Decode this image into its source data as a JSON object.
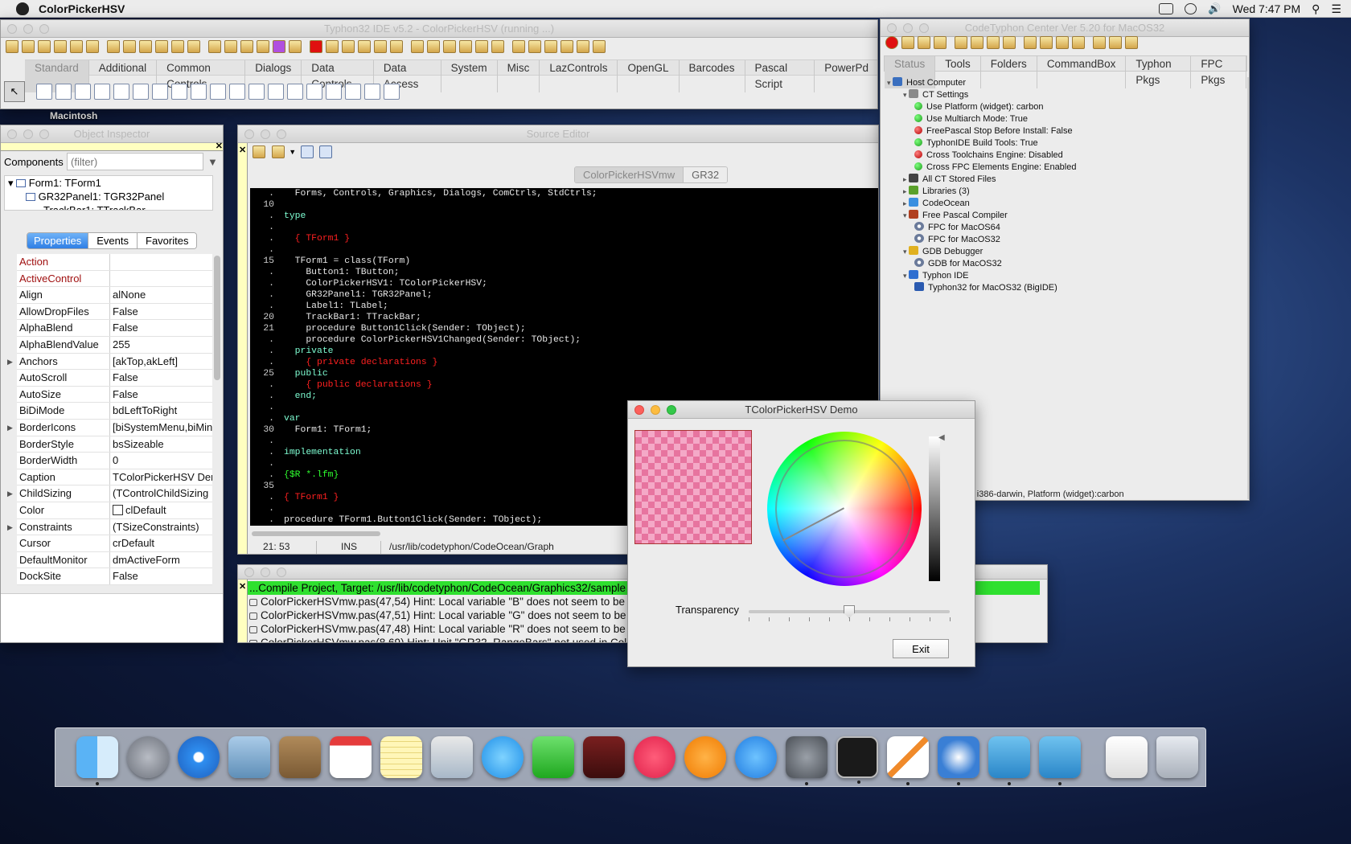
{
  "menubar": {
    "app_name": "ColorPickerHSV",
    "clock": "Wed 7:47 PM"
  },
  "ide": {
    "title": "Typhon32 IDE v5.2 - ColorPickerHSV (running ...)",
    "palette_tabs": [
      "Standard",
      "Additional",
      "Common Controls",
      "Dialogs",
      "Data Controls",
      "Data Access",
      "System",
      "Misc",
      "LazControls",
      "OpenGL",
      "Barcodes",
      "Pascal Script",
      "PowerPd"
    ]
  },
  "desktop_label": "Macintosh",
  "object_inspector": {
    "title": "Object Inspector",
    "components_label": "Components",
    "filter_placeholder": "(filter)",
    "tree": [
      "Form1: TForm1",
      "GR32Panel1: TGR32Panel",
      "TrackBar1: TTrackBar"
    ],
    "tabs": [
      "Properties",
      "Events",
      "Favorites"
    ],
    "properties": [
      {
        "name": "Action",
        "value": "",
        "red": true
      },
      {
        "name": "ActiveControl",
        "value": "",
        "red": true
      },
      {
        "name": "Align",
        "value": "alNone"
      },
      {
        "name": "AllowDropFiles",
        "value": "False"
      },
      {
        "name": "AlphaBlend",
        "value": "False"
      },
      {
        "name": "AlphaBlendValue",
        "value": "255"
      },
      {
        "name": "Anchors",
        "value": "[akTop,akLeft]",
        "expand": true
      },
      {
        "name": "AutoScroll",
        "value": "False"
      },
      {
        "name": "AutoSize",
        "value": "False"
      },
      {
        "name": "BiDiMode",
        "value": "bdLeftToRight"
      },
      {
        "name": "BorderIcons",
        "value": "[biSystemMenu,biMin",
        "expand": true
      },
      {
        "name": "BorderStyle",
        "value": "bsSizeable"
      },
      {
        "name": "BorderWidth",
        "value": "0"
      },
      {
        "name": "Caption",
        "value": "TColorPickerHSV Der"
      },
      {
        "name": "ChildSizing",
        "value": "(TControlChildSizing",
        "expand": true
      },
      {
        "name": "Color",
        "value": "clDefault"
      },
      {
        "name": "Constraints",
        "value": "(TSizeConstraints)",
        "expand": true
      },
      {
        "name": "Cursor",
        "value": "crDefault"
      },
      {
        "name": "DefaultMonitor",
        "value": "dmActiveForm"
      },
      {
        "name": "DockSite",
        "value": "False"
      }
    ]
  },
  "source_editor": {
    "title": "Source Editor",
    "tabs": [
      "ColorPickerHSVmw",
      "GR32"
    ],
    "lines": [
      {
        "n": ".",
        "t": "  Forms, Controls, Graphics, Dialogs, ComCtrls, StdCtrls;",
        "c": "tx"
      },
      {
        "n": "10",
        "t": "",
        "c": "tx"
      },
      {
        "n": ".",
        "t": "type",
        "c": "kw"
      },
      {
        "n": ".",
        "t": "",
        "c": "tx"
      },
      {
        "n": ".",
        "t": "  { TForm1 }",
        "c": "cm"
      },
      {
        "n": ".",
        "t": "",
        "c": "tx"
      },
      {
        "n": "15",
        "t": "  TForm1 = class(TForm)",
        "c": "tx"
      },
      {
        "n": ".",
        "t": "    Button1: TButton;",
        "c": "tx"
      },
      {
        "n": ".",
        "t": "    ColorPickerHSV1: TColorPickerHSV;",
        "c": "tx"
      },
      {
        "n": ".",
        "t": "    GR32Panel1: TGR32Panel;",
        "c": "tx"
      },
      {
        "n": ".",
        "t": "    Label1: TLabel;",
        "c": "tx"
      },
      {
        "n": "20",
        "t": "    TrackBar1: TTrackBar;",
        "c": "tx"
      },
      {
        "n": "21",
        "t": "    procedure Button1Click(Sender: TObject);",
        "c": "tx"
      },
      {
        "n": ".",
        "t": "    procedure ColorPickerHSV1Changed(Sender: TObject);",
        "c": "tx"
      },
      {
        "n": ".",
        "t": "  private",
        "c": "kw"
      },
      {
        "n": ".",
        "t": "    { private declarations }",
        "c": "cm"
      },
      {
        "n": "25",
        "t": "  public",
        "c": "kw"
      },
      {
        "n": ".",
        "t": "    { public declarations }",
        "c": "cm"
      },
      {
        "n": ".",
        "t": "  end;",
        "c": "kw"
      },
      {
        "n": ".",
        "t": "",
        "c": "tx"
      },
      {
        "n": ".",
        "t": "var",
        "c": "kw"
      },
      {
        "n": "30",
        "t": "  Form1: TForm1;",
        "c": "tx"
      },
      {
        "n": ".",
        "t": "",
        "c": "tx"
      },
      {
        "n": ".",
        "t": "implementation",
        "c": "kw"
      },
      {
        "n": ".",
        "t": "",
        "c": "tx"
      },
      {
        "n": ".",
        "t": "{$R *.lfm}",
        "c": "dr"
      },
      {
        "n": "35",
        "t": "",
        "c": "tx"
      },
      {
        "n": ".",
        "t": "{ TForm1 }",
        "c": "cm"
      },
      {
        "n": ".",
        "t": "",
        "c": "tx"
      },
      {
        "n": ".",
        "t": "procedure TForm1.Button1Click(Sender: TObject);",
        "c": "tx"
      }
    ],
    "status_pos": "21: 53",
    "status_mode": "INS",
    "status_path": "/usr/lib/codetyphon/CodeOcean/Graph"
  },
  "messages": {
    "header": "...Compile Project, Target: /usr/lib/codetyphon/CodeOcean/Graphics32/sample",
    "items": [
      "ColorPickerHSVmw.pas(47,54) Hint: Local variable \"B\" does not seem to be ini",
      "ColorPickerHSVmw.pas(47,51) Hint: Local variable \"G\" does not seem to be ini",
      "ColorPickerHSVmw.pas(47,48) Hint: Local variable \"R\" does not seem to be ini",
      "ColorPickerHSVmw.pas(8,69) Hint: Unit \"GR32_RangeBars\" not used in ColorPi"
    ]
  },
  "codetyphon_center": {
    "title": "CodeTyphon Center Ver 5.20 for MacOS32",
    "tabs": [
      "Status",
      "Tools",
      "Folders",
      "CommandBox",
      "Typhon Pkgs",
      "FPC Pkgs"
    ],
    "tree": [
      {
        "label": "Host Computer",
        "level": 0,
        "icon": "computer"
      },
      {
        "label": "CT Settings",
        "level": 1,
        "icon": "tools"
      },
      {
        "label": "Use Platform (widget): carbon",
        "level": 2,
        "icon": "green"
      },
      {
        "label": "Use Multiarch Mode: True",
        "level": 2,
        "icon": "green"
      },
      {
        "label": "FreePascal Stop Before Install: False",
        "level": 2,
        "icon": "red"
      },
      {
        "label": "TyphonIDE Build Tools: True",
        "level": 2,
        "icon": "green"
      },
      {
        "label": "Cross Toolchains Engine: Disabled",
        "level": 2,
        "icon": "red"
      },
      {
        "label": "Cross FPC Elements Engine: Enabled",
        "level": 2,
        "icon": "green"
      },
      {
        "label": "All CT Stored Files",
        "level": 1,
        "icon": "files"
      },
      {
        "label": "Libraries (3)",
        "level": 1,
        "icon": "lib"
      },
      {
        "label": "CodeOcean",
        "level": 1,
        "icon": "ocean"
      },
      {
        "label": "Free Pascal Compiler",
        "level": 1,
        "icon": "fpc"
      },
      {
        "label": "FPC for MacOS64",
        "level": 2,
        "icon": "gear"
      },
      {
        "label": "FPC for MacOS32",
        "level": 2,
        "icon": "gear"
      },
      {
        "label": "GDB Debugger",
        "level": 1,
        "icon": "gdb"
      },
      {
        "label": "GDB for MacOS32",
        "level": 2,
        "icon": "gear"
      },
      {
        "label": "Typhon IDE",
        "level": 1,
        "icon": "typhon"
      },
      {
        "label": "Typhon32 for MacOS32 (BigIDE)",
        "level": 2,
        "icon": "t32"
      }
    ],
    "status_text": "r: i386-darwin, Platform (widget):carbon"
  },
  "demo": {
    "title": "TColorPickerHSV Demo",
    "transparency_label": "Transparency",
    "exit_label": "Exit",
    "transparency_value": 0.5
  }
}
